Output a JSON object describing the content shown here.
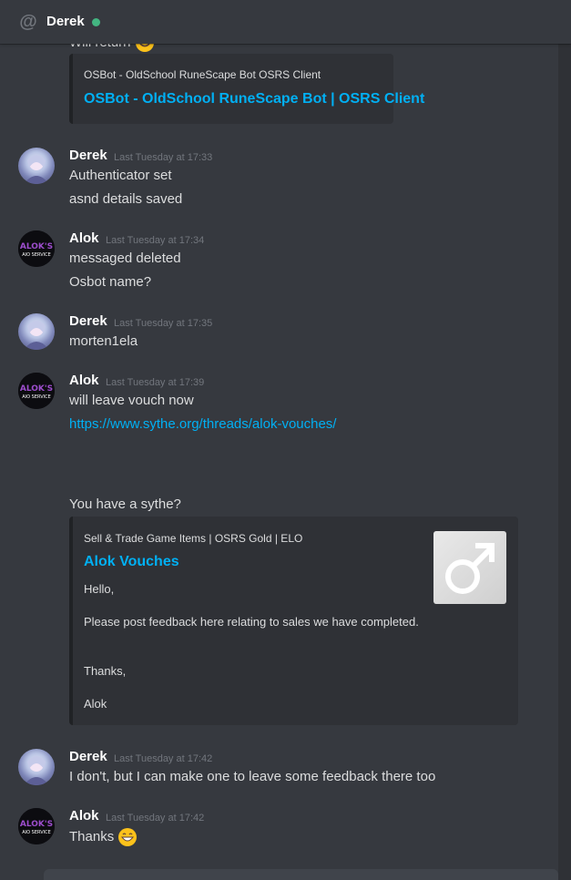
{
  "header": {
    "channel_name": "Derek",
    "status_color": "#43b581"
  },
  "messages_top": {
    "partial_text": "Will return",
    "embed": {
      "provider": "OSBot - OldSchool RuneScape Bot OSRS Client",
      "title": "OSBot - OldSchool RuneScape Bot | OSRS Client"
    }
  },
  "groups": [
    {
      "author": "Derek",
      "timestamp": "Last Tuesday at 17:33",
      "lines": [
        "Authenticator set",
        "asnd details saved"
      ]
    },
    {
      "author": "Alok",
      "timestamp": "Last Tuesday at 17:34",
      "lines": [
        "messaged deleted",
        "Osbot name?"
      ]
    },
    {
      "author": "Derek",
      "timestamp": "Last Tuesday at 17:35",
      "lines": [
        "morten1ela"
      ]
    },
    {
      "author": "Alok",
      "timestamp": "Last Tuesday at 17:39",
      "lines": [
        "will leave vouch now"
      ],
      "link": "https://www.sythe.org/threads/alok-vouches/",
      "followup": "You have a sythe?",
      "embed": {
        "provider": "Sell & Trade Game Items | OSRS Gold | ELO",
        "title": "Alok Vouches",
        "desc": [
          "Hello,",
          "Please post feedback here relating to sales we have completed.",
          "Thanks,",
          "Alok"
        ],
        "thumbnail_icon": "male-symbol-icon"
      }
    },
    {
      "author": "Derek",
      "timestamp": "Last Tuesday at 17:42",
      "lines": [
        "I don't, but I can make one to leave some feedback there too"
      ]
    },
    {
      "author": "Alok",
      "timestamp": "Last Tuesday at 17:42",
      "lines": [
        "Thanks"
      ],
      "emoji": "grinning-face-icon"
    }
  ],
  "avatar_alok_text": [
    "ALOK'S",
    "AIO SERVICE"
  ],
  "colors": {
    "link": "#00b0f4",
    "background": "#36393f",
    "embed_bg": "#2f3136"
  }
}
